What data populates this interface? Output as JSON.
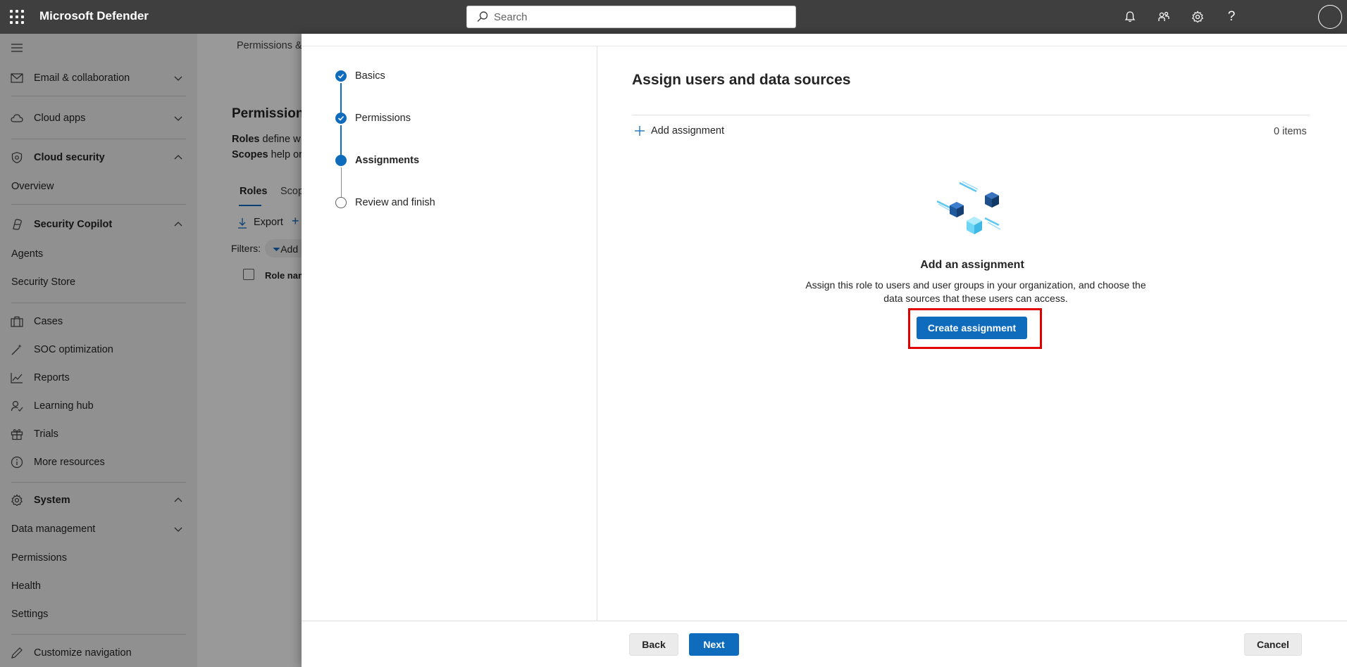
{
  "app": {
    "title": "Microsoft Defender"
  },
  "search": {
    "placeholder": "Search"
  },
  "sidebar": {
    "items": [
      {
        "label": "Email & collaboration"
      },
      {
        "label": "Cloud apps"
      },
      {
        "label": "Cloud security"
      },
      {
        "label": "Overview"
      },
      {
        "label": "Security Copilot"
      },
      {
        "label": "Agents"
      },
      {
        "label": "Security Store"
      },
      {
        "label": "Cases"
      },
      {
        "label": "SOC optimization"
      },
      {
        "label": "Reports"
      },
      {
        "label": "Learning hub"
      },
      {
        "label": "Trials"
      },
      {
        "label": "More resources"
      },
      {
        "label": "System"
      },
      {
        "label": "Data management"
      },
      {
        "label": "Permissions"
      },
      {
        "label": "Health"
      },
      {
        "label": "Settings"
      },
      {
        "label": "Customize navigation"
      }
    ]
  },
  "background": {
    "breadcrumb": "Permissions &",
    "title": "Permission",
    "line1_bold": "Roles",
    "line1_rest": "define w",
    "line2_bold": "Scopes",
    "line2_rest": "help or",
    "tab_roles": "Roles",
    "tab_scopes": "Scop",
    "export": "Export",
    "filters": "Filters:",
    "add_filter": "Add",
    "col_role_name": "Role nam"
  },
  "wizard": {
    "steps": [
      {
        "label": "Basics",
        "state": "done"
      },
      {
        "label": "Permissions",
        "state": "done"
      },
      {
        "label": "Assignments",
        "state": "current"
      },
      {
        "label": "Review and finish",
        "state": "todo"
      }
    ],
    "heading": "Assign users and data sources",
    "add_assignment": "Add assignment",
    "items_count": "0 items",
    "empty_title": "Add an assignment",
    "empty_desc": "Assign this role to users and user groups in your organization, and choose the data sources that these users can access.",
    "create_assignment": "Create assignment",
    "back": "Back",
    "next": "Next",
    "cancel": "Cancel"
  },
  "colors": {
    "accent": "#0f6cbd",
    "topbar": "#3f3f3f",
    "highlight": "#e00000"
  }
}
